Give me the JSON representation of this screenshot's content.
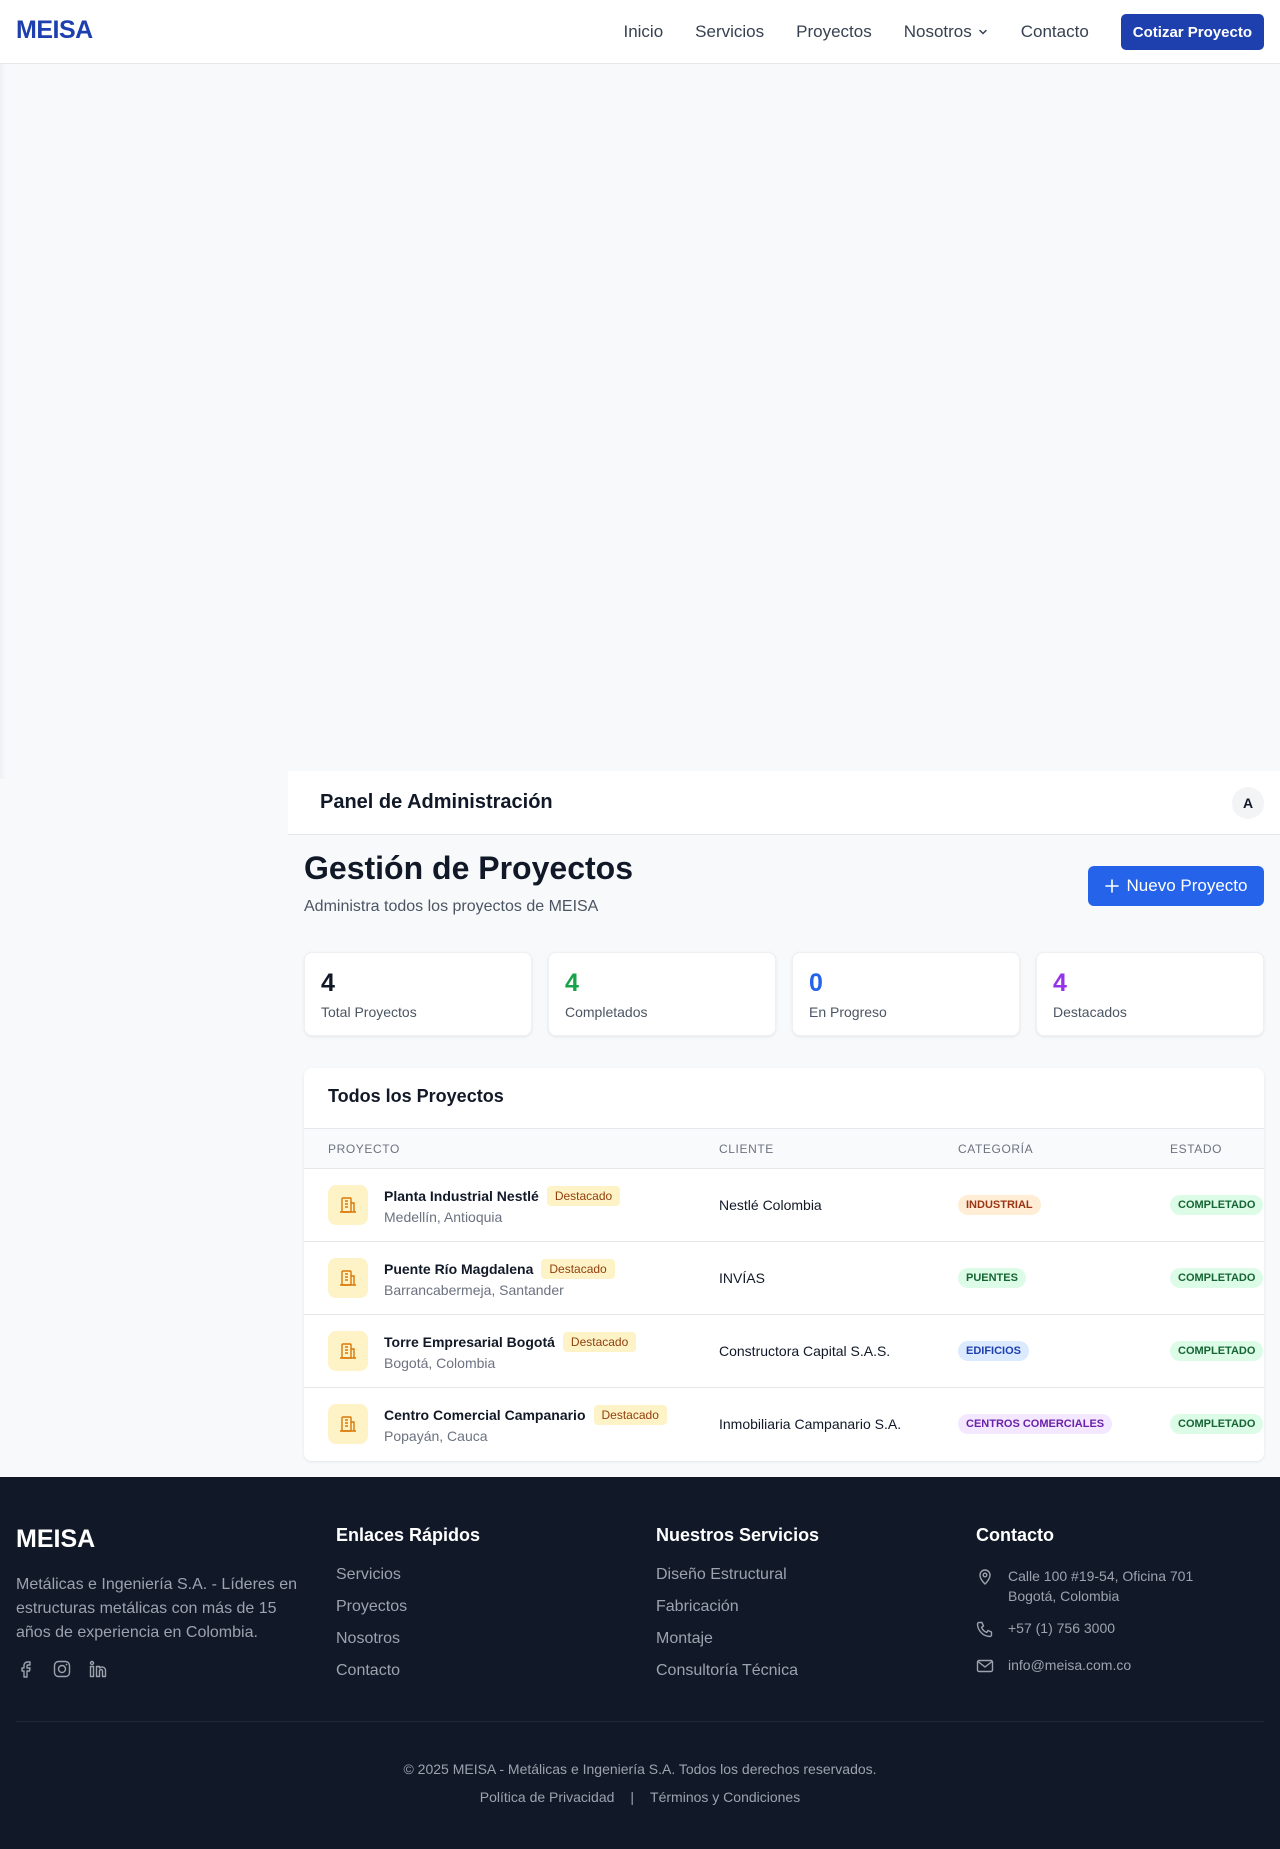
{
  "nav": {
    "logo": "MEISA",
    "links": [
      "Inicio",
      "Servicios",
      "Proyectos",
      "Nosotros",
      "Contacto"
    ],
    "cta": "Cotizar Proyecto"
  },
  "admin": {
    "title": "Panel de Administración",
    "avatar": "A"
  },
  "page": {
    "title": "Gestión de Proyectos",
    "subtitle": "Administra todos los proyectos de MEISA",
    "new_button": "Nuevo Proyecto"
  },
  "stats": [
    {
      "value": "4",
      "label": "Total Proyectos",
      "color": "#111827"
    },
    {
      "value": "4",
      "label": "Completados",
      "color": "#16a34a"
    },
    {
      "value": "0",
      "label": "En Progreso",
      "color": "#2563eb"
    },
    {
      "value": "4",
      "label": "Destacados",
      "color": "#9333ea"
    }
  ],
  "table": {
    "title": "Todos los Proyectos",
    "headers": [
      "PROYECTO",
      "CLIENTE",
      "CATEGORÍA",
      "ESTADO"
    ],
    "rows": [
      {
        "name": "Planta Industrial Nestlé",
        "badge": "Destacado",
        "location": "Medellín, Antioquia",
        "client": "Nestlé Colombia",
        "category": "INDUSTRIAL",
        "status": "COMPLETADO"
      },
      {
        "name": "Puente Río Magdalena",
        "badge": "Destacado",
        "location": "Barrancabermeja, Santander",
        "client": "INVÍAS",
        "category": "PUENTES",
        "status": "COMPLETADO"
      },
      {
        "name": "Torre Empresarial Bogotá",
        "badge": "Destacado",
        "location": "Bogotá, Colombia",
        "client": "Constructora Capital S.A.S.",
        "category": "EDIFICIOS",
        "status": "COMPLETADO"
      },
      {
        "name": "Centro Comercial Campanario",
        "badge": "Destacado",
        "location": "Popayán, Cauca",
        "client": "Inmobiliaria Campanario S.A.",
        "category": "CENTROS COMERCIALES",
        "status": "COMPLETADO"
      }
    ]
  },
  "category_colors": {
    "INDUSTRIAL": {
      "bg": "#ffedd5",
      "fg": "#9a3412"
    },
    "PUENTES": {
      "bg": "#dcfce7",
      "fg": "#166534"
    },
    "EDIFICIOS": {
      "bg": "#dbeafe",
      "fg": "#1e40af"
    },
    "CENTROS COMERCIALES": {
      "bg": "#f3e8ff",
      "fg": "#6b21a8"
    }
  },
  "footer": {
    "logo": "MEISA",
    "description": "Metálicas e Ingeniería S.A. - Líderes en estructuras metálicas con más de 15 años de experiencia en Colombia.",
    "quick_links_title": "Enlaces Rápidos",
    "quick_links": [
      "Servicios",
      "Proyectos",
      "Nosotros",
      "Contacto"
    ],
    "services_title": "Nuestros Servicios",
    "services": [
      "Diseño Estructural",
      "Fabricación",
      "Montaje",
      "Consultoría Técnica"
    ],
    "contact_title": "Contacto",
    "address_line1": "Calle 100 #19-54, Oficina 701",
    "address_line2": "Bogotá, Colombia",
    "phone": "+57 (1) 756 3000",
    "email": "info@meisa.com.co",
    "copyright": "© 2025 MEISA - Metálicas e Ingeniería S.A. Todos los derechos reservados.",
    "privacy": "Política de Privacidad",
    "terms": "Términos y Condiciones"
  }
}
